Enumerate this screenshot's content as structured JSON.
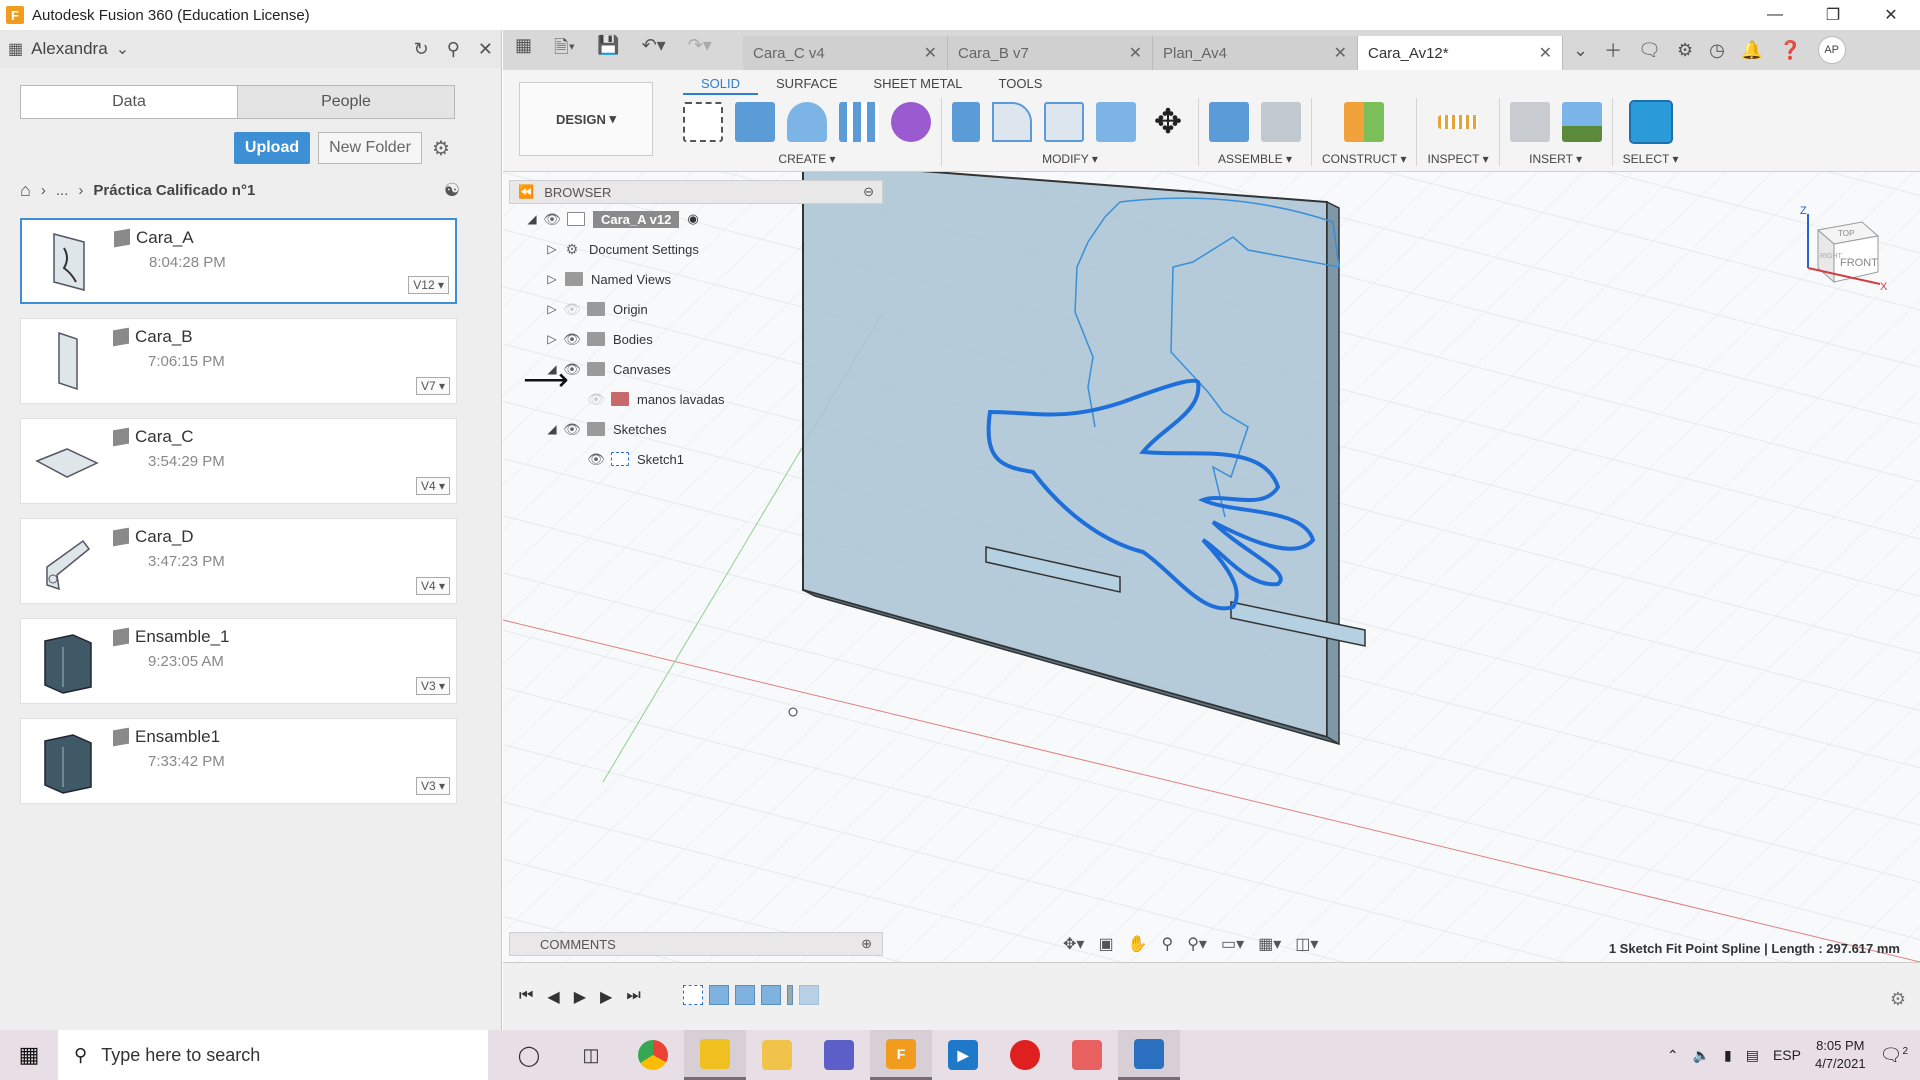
{
  "window": {
    "title": "Autodesk Fusion 360 (Education License)",
    "app_glyph": "F"
  },
  "data_panel": {
    "user": "Alexandra",
    "tabs": [
      "Data",
      "People"
    ],
    "upload_label": "Upload",
    "new_folder_label": "New Folder",
    "breadcrumb_ellipsis": "...",
    "folder": "Práctica Calificado n°1",
    "files": [
      {
        "name": "Cara_A",
        "time": "8:04:28 PM",
        "version": "V12",
        "selected": true
      },
      {
        "name": "Cara_B",
        "time": "7:06:15 PM",
        "version": "V7"
      },
      {
        "name": "Cara_C",
        "time": "3:54:29 PM",
        "version": "V4"
      },
      {
        "name": "Cara_D",
        "time": "3:47:23 PM",
        "version": "V4"
      },
      {
        "name": "Ensamble_1",
        "time": "9:23:05 AM",
        "version": "V3"
      },
      {
        "name": "Ensamble1",
        "time": "7:33:42 PM",
        "version": "V3"
      }
    ]
  },
  "doc_tabs": [
    {
      "label": "Cara_C v4"
    },
    {
      "label": "Cara_B v7"
    },
    {
      "label": "Plan_Av4"
    },
    {
      "label": "Cara_Av12*",
      "active": true
    }
  ],
  "user_initials": "AP",
  "toolbar": {
    "workspace_label": "DESIGN",
    "workspace_tabs": [
      "SOLID",
      "SURFACE",
      "SHEET METAL",
      "TOOLS"
    ],
    "groups": [
      "CREATE",
      "MODIFY",
      "ASSEMBLE",
      "CONSTRUCT",
      "INSPECT",
      "INSERT",
      "SELECT"
    ]
  },
  "browser": {
    "title": "BROWSER",
    "root": "Cara_A v12",
    "items": [
      {
        "label": "Document Settings",
        "icon": "gear-icon"
      },
      {
        "label": "Named Views",
        "icon": "folder-icon"
      },
      {
        "label": "Origin",
        "icon": "folder-icon"
      },
      {
        "label": "Bodies",
        "icon": "folder-icon"
      },
      {
        "label": "Canvases",
        "icon": "folder-icon"
      },
      {
        "label": "manos lavadas",
        "icon": "image-icon"
      },
      {
        "label": "Sketches",
        "icon": "folder-icon"
      },
      {
        "label": "Sketch1",
        "icon": "sketch-icon"
      }
    ]
  },
  "comments_label": "COMMENTS",
  "status_text": "1 Sketch Fit Point Spline | Length : 297.617 mm",
  "viewcube": {
    "top": "TOP",
    "front": "FRONT",
    "right": "RIGHT",
    "axis_x": "X",
    "axis_z": "Z"
  },
  "taskbar": {
    "search_placeholder": "Type here to search",
    "language": "ESP",
    "time": "8:05 PM",
    "date": "4/7/2021",
    "notification_count": "2"
  },
  "colors": {
    "accent": "#3d8fd6",
    "plate": "#a9c3d3",
    "spline": "#1e6fd9"
  }
}
